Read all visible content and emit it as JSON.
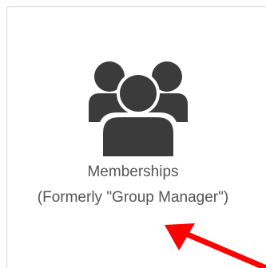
{
  "tile": {
    "title": "Memberships",
    "subtitle": "(Formerly \"Group Manager\")",
    "icon": "users-group-icon",
    "icon_color": "#3b3b3b",
    "text_color": "#555555",
    "border_color": "#d6d6d6"
  },
  "annotation": {
    "arrow_color": "#ff0000"
  }
}
